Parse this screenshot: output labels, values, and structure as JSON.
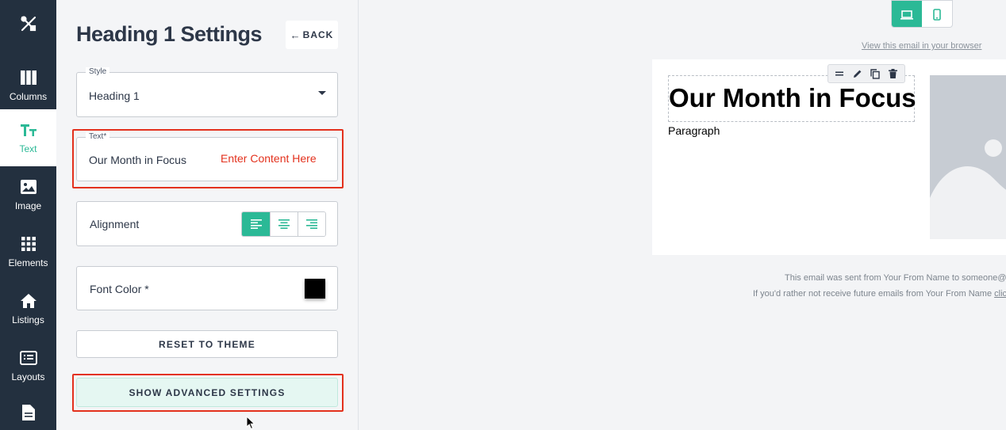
{
  "rail": {
    "items": [
      {
        "label": "Columns",
        "icon": "columns-icon"
      },
      {
        "label": "Text",
        "icon": "text-icon",
        "active": true
      },
      {
        "label": "Image",
        "icon": "image-icon"
      },
      {
        "label": "Elements",
        "icon": "grid-icon"
      },
      {
        "label": "Listings",
        "icon": "home-icon"
      },
      {
        "label": "Layouts",
        "icon": "layout-icon"
      },
      {
        "label": "",
        "icon": "document-icon"
      }
    ],
    "logo_icon": "tools-icon"
  },
  "panel": {
    "title": "Heading 1 Settings",
    "back_label": "BACK",
    "style_legend": "Style",
    "style_value": "Heading 1",
    "text_legend": "Text*",
    "text_value": "Our Month in Focus",
    "text_hint": "Enter Content Here",
    "alignment_label": "Alignment",
    "alignment_selected": "left",
    "font_color_label": "Font Color *",
    "font_color_value": "#000000",
    "reset_label": "RESET TO THEME",
    "advanced_label": "SHOW ADVANCED SETTINGS"
  },
  "preview": {
    "device_selected": "desktop",
    "view_in_browser": "View this email in your browser",
    "heading": "Our Month in Focus",
    "paragraph": "Paragraph",
    "footer_sent": "This email was sent from Your From Name to someone@",
    "footer_unsub": "If you'd rather not receive future emails from Your From Name ",
    "footer_unsub_link": "clic"
  },
  "colors": {
    "accent": "#2bb996",
    "rail_bg": "#23303f",
    "highlight_red": "#e3311d"
  }
}
